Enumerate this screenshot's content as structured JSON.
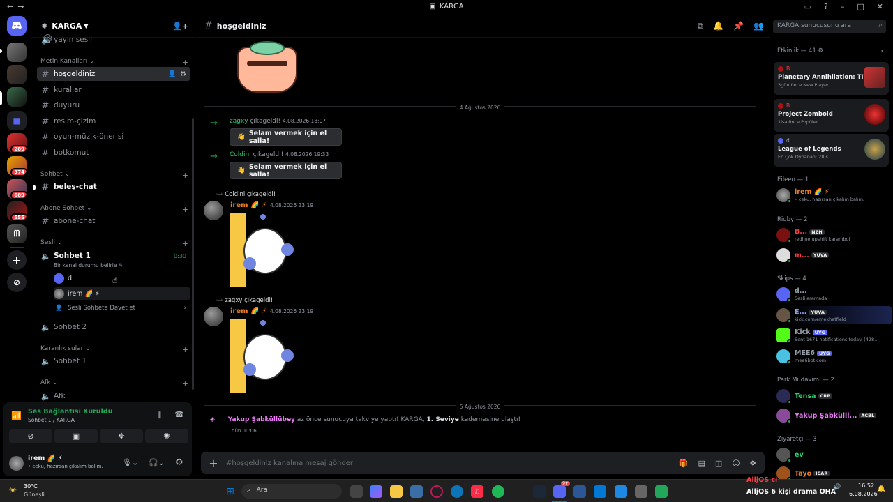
{
  "window": {
    "title": "KARGA"
  },
  "server": {
    "name": "KARGA",
    "channel_above": "yayın sesli"
  },
  "categories": {
    "text": "Metin Kanalları",
    "chat": "Sohbet",
    "sub": "Abone Sohbet",
    "voice": "Sesli",
    "dark": "Karanlık sular",
    "afk": "Afk"
  },
  "text_channels": [
    "hoşgeldiniz",
    "kurallar",
    "duyuru",
    "resim-çizim",
    "oyun-müzik-önerisi",
    "botkomut"
  ],
  "chat_channel": "beleş-chat",
  "sub_channel": "abone-chat",
  "voice": {
    "channel1": "Sohbet 1",
    "timer": "0:30",
    "status_hint": "Bir kanal durumu belirle",
    "users": [
      "d...",
      "irem 🌈 ⚡"
    ],
    "invite": "Sesli Sohbete Davet et",
    "channel2": "Sohbet 2",
    "dark_channel": "Sohbet 1",
    "afk_channel": "Afk"
  },
  "rail_badges": [
    "289",
    "374",
    "689",
    "555"
  ],
  "voice_panel": {
    "status": "Ses Bağlantısı Kuruldu",
    "location": "Sohbet 1 / KARGA"
  },
  "user_panel": {
    "name": "irem 🌈 ⚡",
    "status": "• ceku, hazırsan çıkalım balım."
  },
  "chat": {
    "channel": "hoşgeldiniz",
    "date1": "4 Ağustos 2026",
    "date2": "5 Ağustos 2026",
    "join1": {
      "user": "zagxy",
      "text": "çıkageldi!",
      "time": "4.08.2026 18:07"
    },
    "join2": {
      "user": "Coldini",
      "text": "çıkageldi!",
      "time": "4.08.2026 19:33"
    },
    "wave_label": "Selam vermek için el salla!",
    "msg1": {
      "reply": "Coldini çıkageldi!",
      "author": "irem 🌈 ⚡",
      "time": "4.08.2026 23:19"
    },
    "msg2": {
      "reply": "zagxy çıkageldi!",
      "author": "irem 🌈 ⚡",
      "time": "4.08.2026 23:19"
    },
    "boost": {
      "user": "Yakup Şabküllübey",
      "text1": "az önce sunucuya takviye yaptı! KARGA,",
      "level": "1. Seviye",
      "text2": "kademesine ulaştı!",
      "time": "dün 00:06"
    },
    "input_placeholder": "#hoşgeldiniz kanalına mesaj gönder"
  },
  "search_placeholder": "KARGA sunucusunu ara",
  "members": {
    "activity_header": "Etkinlik — 41",
    "activities": [
      {
        "src": "B...",
        "game": "Planetary Annihilation: TIT...",
        "meta": "3gün önce  New Player"
      },
      {
        "src": "B...",
        "game": "Project Zomboid",
        "meta": "1lsa önce  Popüler"
      },
      {
        "src": "d...",
        "game": "League of Legends",
        "meta": "En Çok Oynanan: 28 s"
      }
    ],
    "groups": [
      {
        "title": "Eileen — 1",
        "members": [
          {
            "name": "irem 🌈 ⚡",
            "status": "• ceku, hazırsan çıkalım balım.",
            "color": "#e67e22"
          }
        ]
      },
      {
        "title": "Rigby — 2",
        "members": [
          {
            "name": "B...",
            "tag": "NZH",
            "status": "redline upshift karambol",
            "color": "#f23f43"
          },
          {
            "name": "m...",
            "tag": "YUVA",
            "status": "",
            "color": "#f23f43"
          }
        ]
      },
      {
        "title": "Skips — 4",
        "members": [
          {
            "name": "d...",
            "status": "Sesli aramada",
            "color": "#949ba4"
          },
          {
            "name": "E...",
            "tag": "YUVA",
            "status": "kick.com/emekhetfield",
            "color": "#8ea1e1"
          },
          {
            "name": "Kick",
            "tag": "UYG",
            "status": "Sent 1671 notifications today. (428...",
            "color": "#949ba4"
          },
          {
            "name": "MEE6",
            "tag": "UYG",
            "status": "mee6bot.com",
            "color": "#949ba4"
          }
        ]
      },
      {
        "title": "Park Müdavimi — 2",
        "members": [
          {
            "name": "Tensa",
            "tag": "CRP",
            "status": "",
            "color": "#2ecc71"
          },
          {
            "name": "Yakup Şabkülll...",
            "tag": "ACBL",
            "status": "",
            "color": "#f47fff"
          }
        ]
      },
      {
        "title": "Ziyaretçi — 3",
        "members": [
          {
            "name": "ev",
            "status": "",
            "color": "#2ecc71"
          },
          {
            "name": "Tayo",
            "tag": "ICAR",
            "status": "",
            "color": "#e67e22"
          }
        ]
      }
    ]
  },
  "taskbar": {
    "weather_temp": "30°C",
    "weather_desc": "Güneşli",
    "search": "Ara",
    "overlay1": "AlljOS ci",
    "overlay2": "AlljOS  6 kişi drama OHA",
    "time": "16:52",
    "date": "6.08.2026",
    "discord_badge": "9+"
  }
}
